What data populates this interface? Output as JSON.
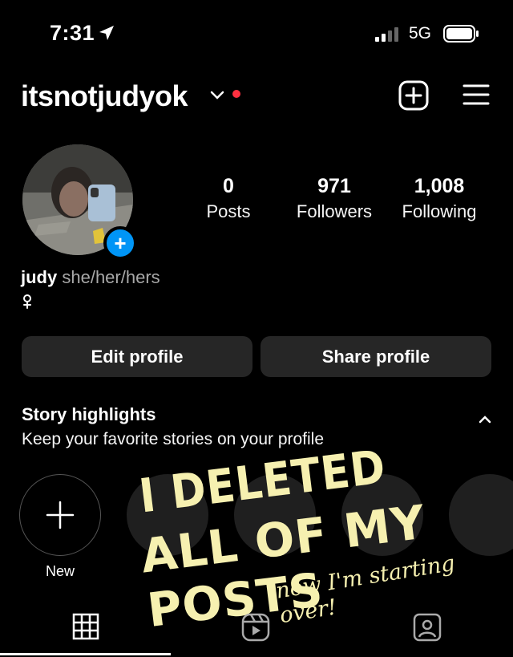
{
  "status_bar": {
    "time": "7:31",
    "network": "5G"
  },
  "header": {
    "username": "itsnotjudyok"
  },
  "profile": {
    "stats": [
      {
        "value": "0",
        "label": "Posts"
      },
      {
        "value": "971",
        "label": "Followers"
      },
      {
        "value": "1,008",
        "label": "Following"
      }
    ],
    "name": "judy",
    "pronouns": "she/her/hers"
  },
  "buttons": {
    "edit": "Edit profile",
    "share": "Share profile"
  },
  "highlights": {
    "title": "Story highlights",
    "subtitle": "Keep your favorite stories on your profile",
    "new_label": "New"
  },
  "overlay": {
    "line1": "I DELETED",
    "line2": "ALL OF MY POSTS",
    "line3": "now I'm starting over!"
  },
  "colors": {
    "accent_blue": "#0095f6",
    "notification_red": "#ff3040",
    "button_bg": "#262626",
    "overlay_text": "#f6f0b0"
  }
}
